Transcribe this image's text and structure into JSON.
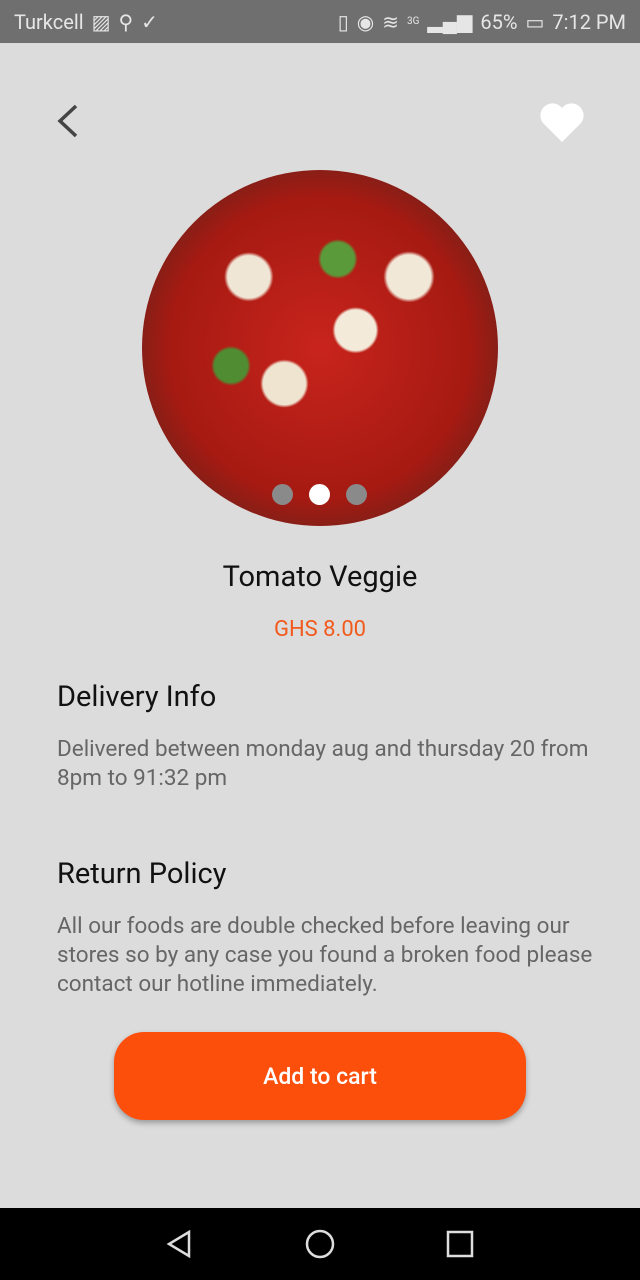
{
  "status": {
    "carrier": "Turkcell",
    "network": "3G",
    "battery": "65%",
    "time": "7:12 PM"
  },
  "product": {
    "name": "Tomato Veggie",
    "price": "GHS 8.00",
    "image_count": 3,
    "active_image": 2
  },
  "delivery": {
    "heading": "Delivery Info",
    "text": "Delivered between monday aug and thursday 20 from 8pm to 91:32 pm"
  },
  "returns": {
    "heading": "Return Policy",
    "text": "All our foods are double checked before leaving our stores so by any case you found a broken food please contact our hotline immediately."
  },
  "cart_button": "Add to cart",
  "colors": {
    "accent": "#fd4f0c",
    "price": "#f25a1c"
  }
}
